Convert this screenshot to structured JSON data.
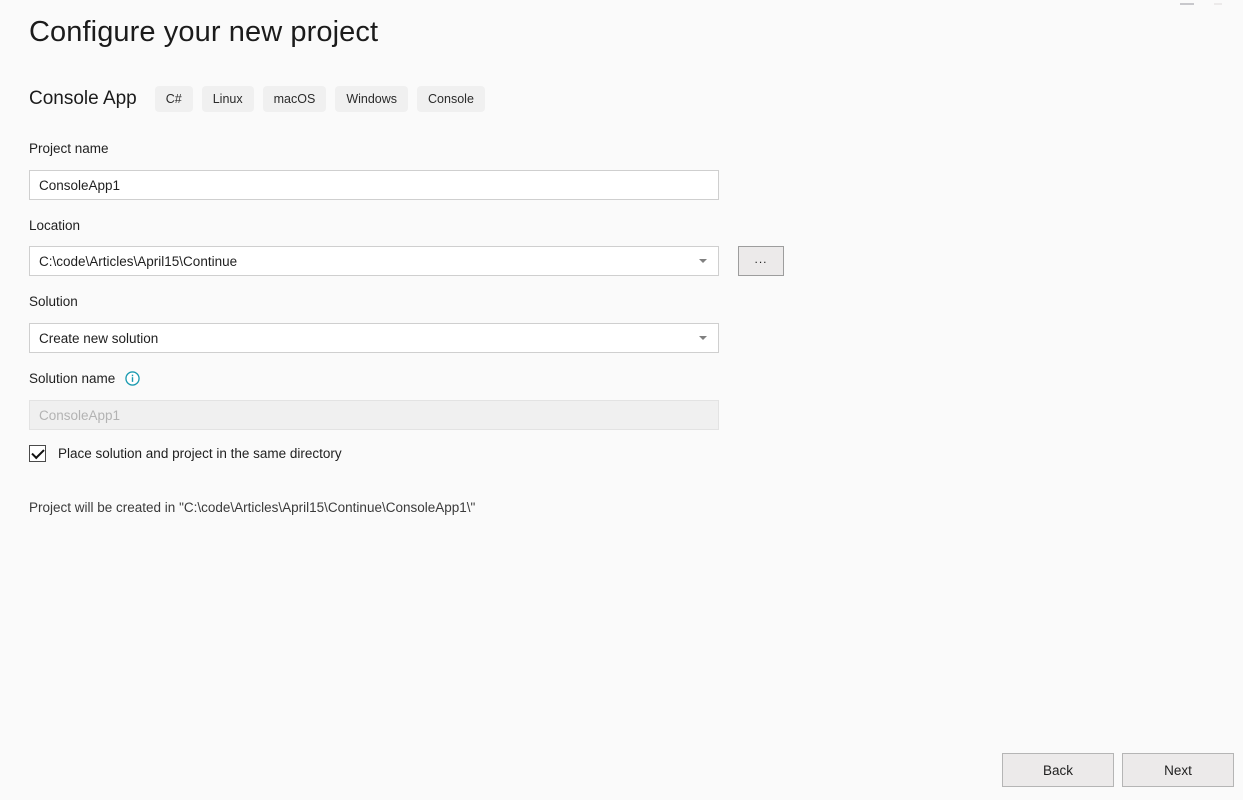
{
  "window": {
    "minimize_icon": "minimize-icon",
    "close_icon": "close-icon"
  },
  "header": {
    "title": "Configure your new project",
    "template_name": "Console App",
    "tags": [
      "C#",
      "Linux",
      "macOS",
      "Windows",
      "Console"
    ]
  },
  "form": {
    "project_name": {
      "label": "Project name",
      "value": "ConsoleApp1"
    },
    "location": {
      "label": "Location",
      "value": "C:\\code\\Articles\\April15\\Continue",
      "browse_label": "..."
    },
    "solution": {
      "label": "Solution",
      "value": "Create new solution"
    },
    "solution_name": {
      "label": "Solution name",
      "value": "ConsoleApp1",
      "info_icon": "info-icon",
      "disabled": true
    },
    "same_directory": {
      "label": "Place solution and project in the same directory",
      "checked": true
    }
  },
  "status": {
    "text": "Project will be created in \"C:\\code\\Articles\\April15\\Continue\\ConsoleApp1\\\""
  },
  "footer": {
    "back_label": "Back",
    "next_label": "Next"
  },
  "colors": {
    "background": "#fafafa",
    "accent_info": "#1a9ab0",
    "tag_background": "#f0f0f0",
    "button_background": "#eceaea",
    "input_border": "#cfcfcf",
    "disabled_background": "#f0f0f0"
  }
}
